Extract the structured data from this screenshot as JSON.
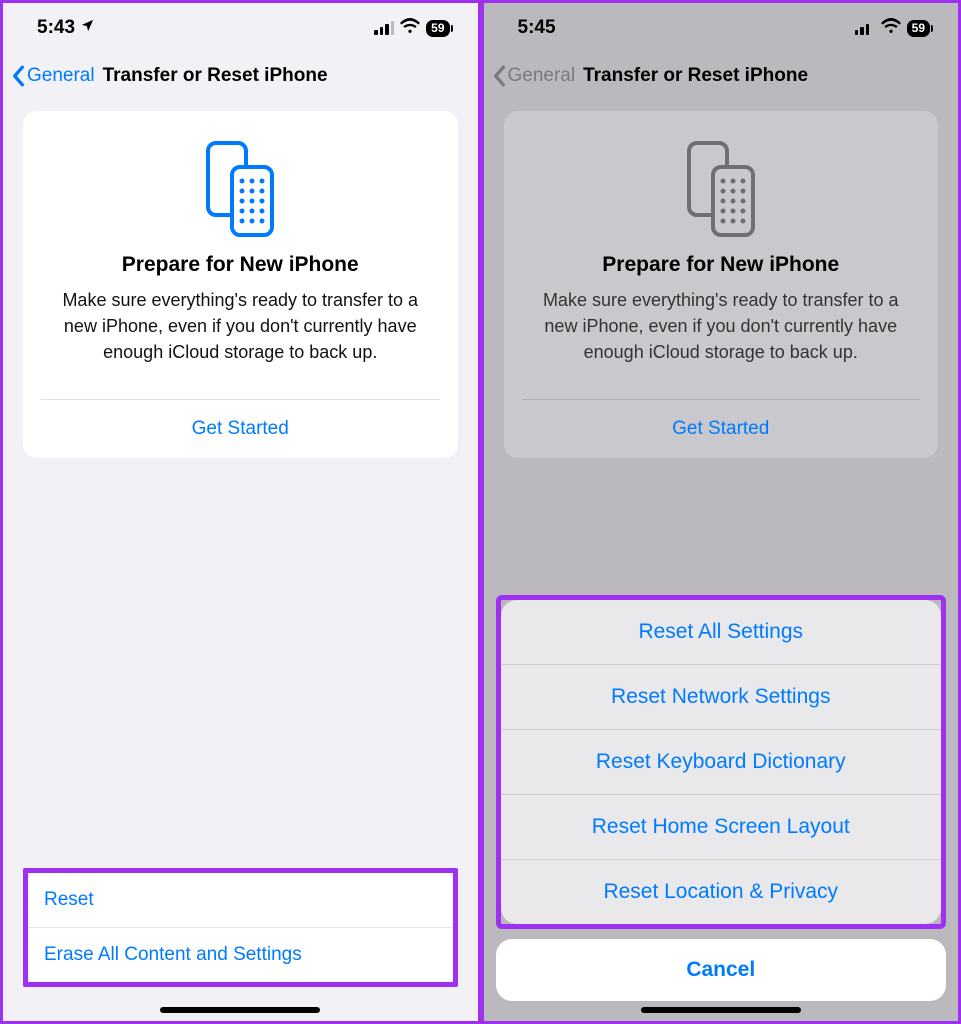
{
  "left": {
    "status": {
      "time": "5:43",
      "battery": "59"
    },
    "nav": {
      "back": "General",
      "title": "Transfer or Reset iPhone"
    },
    "card": {
      "title": "Prepare for New iPhone",
      "desc": "Make sure everything's ready to transfer to a new iPhone, even if you don't currently have enough iCloud storage to back up.",
      "action": "Get Started"
    },
    "options": {
      "reset": "Reset",
      "erase": "Erase All Content and Settings"
    },
    "accent": "#007aff"
  },
  "right": {
    "status": {
      "time": "5:45",
      "battery": "59"
    },
    "nav": {
      "back": "General",
      "title": "Transfer or Reset iPhone"
    },
    "card": {
      "title": "Prepare for New iPhone",
      "desc": "Make sure everything's ready to transfer to a new iPhone, even if you don't currently have enough iCloud storage to back up.",
      "action": "Get Started"
    },
    "sheet": {
      "items": [
        "Reset All Settings",
        "Reset Network Settings",
        "Reset Keyboard Dictionary",
        "Reset Home Screen Layout",
        "Reset Location & Privacy"
      ],
      "cancel": "Cancel"
    },
    "accent": "#007aff"
  },
  "highlight_color": "#a030f0"
}
